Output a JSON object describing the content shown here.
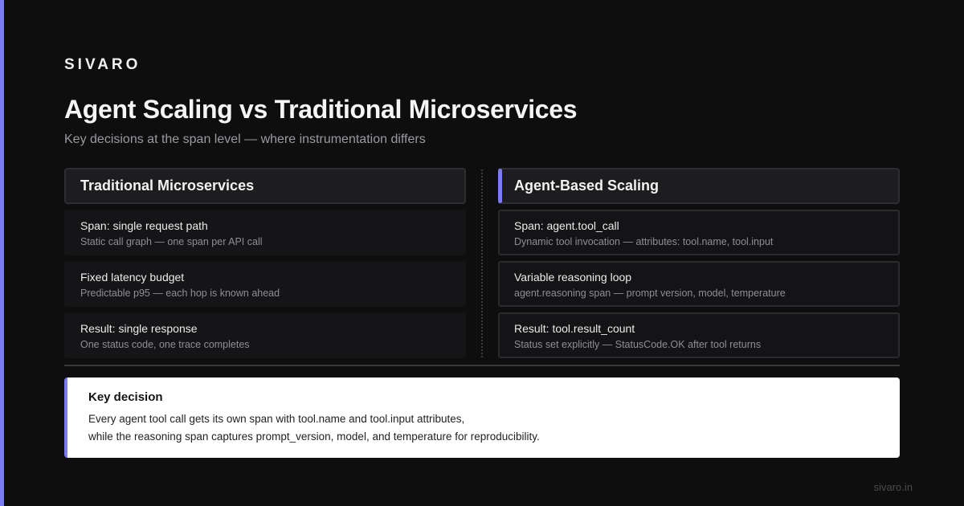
{
  "brand": "SIVARO",
  "title": "Agent Scaling vs Traditional Microservices",
  "subtitle": "Key decisions at the span level — where instrumentation differs",
  "left": {
    "header": "Traditional Microservices",
    "cards": [
      {
        "title": "Span: single request path",
        "desc": "Static call graph — one span per API call"
      },
      {
        "title": "Fixed latency budget",
        "desc": "Predictable p95 — each hop is known ahead"
      },
      {
        "title": "Result: single response",
        "desc": "One status code, one trace completes"
      }
    ]
  },
  "right": {
    "header": "Agent-Based Scaling",
    "cards": [
      {
        "title": "Span: agent.tool_call",
        "desc": "Dynamic tool invocation — attributes: tool.name, tool.input"
      },
      {
        "title": "Variable reasoning loop",
        "desc": "agent.reasoning span — prompt version, model, temperature"
      },
      {
        "title": "Result: tool.result_count",
        "desc": "Status set explicitly — StatusCode.OK after tool returns"
      }
    ]
  },
  "decision": {
    "title": "Key decision",
    "line1": "Every agent tool call gets its own span with tool.name and tool.input attributes,",
    "line2": "while the reasoning span captures prompt_version, model, and temperature for reproducibility."
  },
  "footer": "sivaro.in",
  "colors": {
    "accent": "#7a7cf0",
    "background": "#0e0e0f",
    "card": "#151517"
  }
}
